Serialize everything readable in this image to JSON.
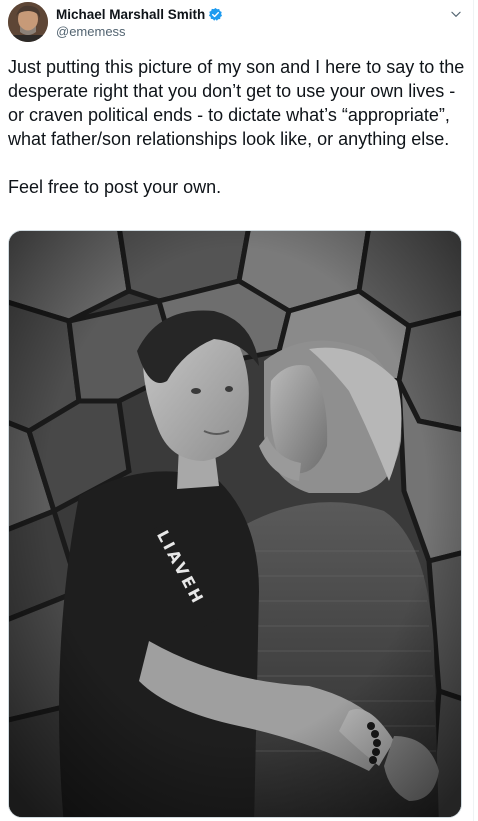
{
  "tweet": {
    "author": {
      "display_name": "Michael Marshall Smith",
      "handle": "@ememess",
      "verified": true
    },
    "text": "Just putting this picture of my son and I here to say to the desperate right that you don’t get to use your own lives - or craven political ends - to dictate what’s “appropriate”, what father/son relationships look like, or anything else.\n\nFeel free to post your own.",
    "media": {
      "kind": "photo",
      "tone": "black-and-white"
    }
  },
  "icons": {
    "verified": "verified-badge-icon",
    "more": "chevron-down-icon"
  },
  "colors": {
    "text_primary": "#0f1419",
    "text_secondary": "#536471",
    "verified_blue": "#1d9bf0",
    "border": "#cfd9de"
  }
}
